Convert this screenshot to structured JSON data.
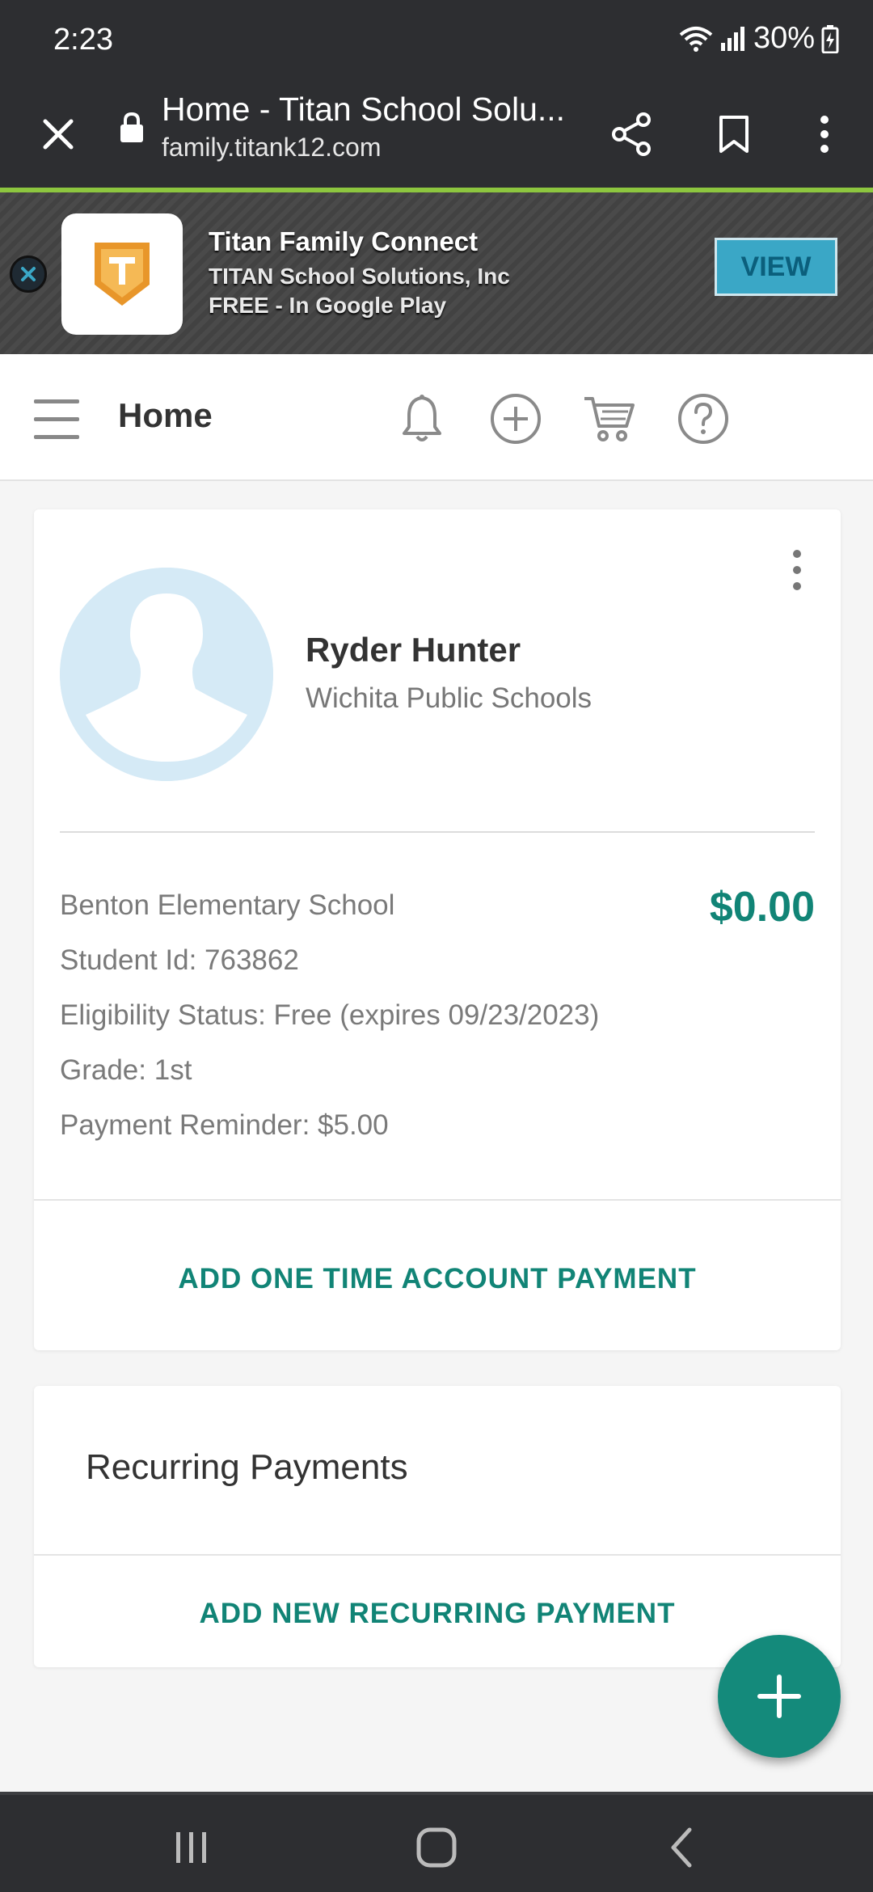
{
  "status_bar": {
    "time": "2:23",
    "battery": "30%"
  },
  "browser": {
    "title": "Home - Titan School Solu...",
    "url": "family.titank12.com"
  },
  "app_banner": {
    "name": "Titan Family Connect",
    "publisher": "TITAN School Solutions, Inc",
    "price_line": "FREE - In Google Play",
    "view_label": "VIEW",
    "icon_letter": "T"
  },
  "header": {
    "title": "Home"
  },
  "student": {
    "name": "Ryder Hunter",
    "district": "Wichita Public Schools",
    "school": "Benton Elementary School",
    "balance": "$0.00",
    "student_id": "Student Id: 763862",
    "eligibility": "Eligibility Status: Free (expires 09/23/2023)",
    "grade": "Grade: 1st",
    "payment_reminder": "Payment Reminder: $5.00",
    "add_payment_label": "ADD ONE TIME ACCOUNT PAYMENT"
  },
  "recurring": {
    "title": "Recurring Payments",
    "add_label": "ADD NEW RECURRING PAYMENT"
  },
  "colors": {
    "accent": "#118476",
    "fab": "#148a7b",
    "accent_line": "#8dc63f",
    "banner_button": "#3aa7c6"
  }
}
